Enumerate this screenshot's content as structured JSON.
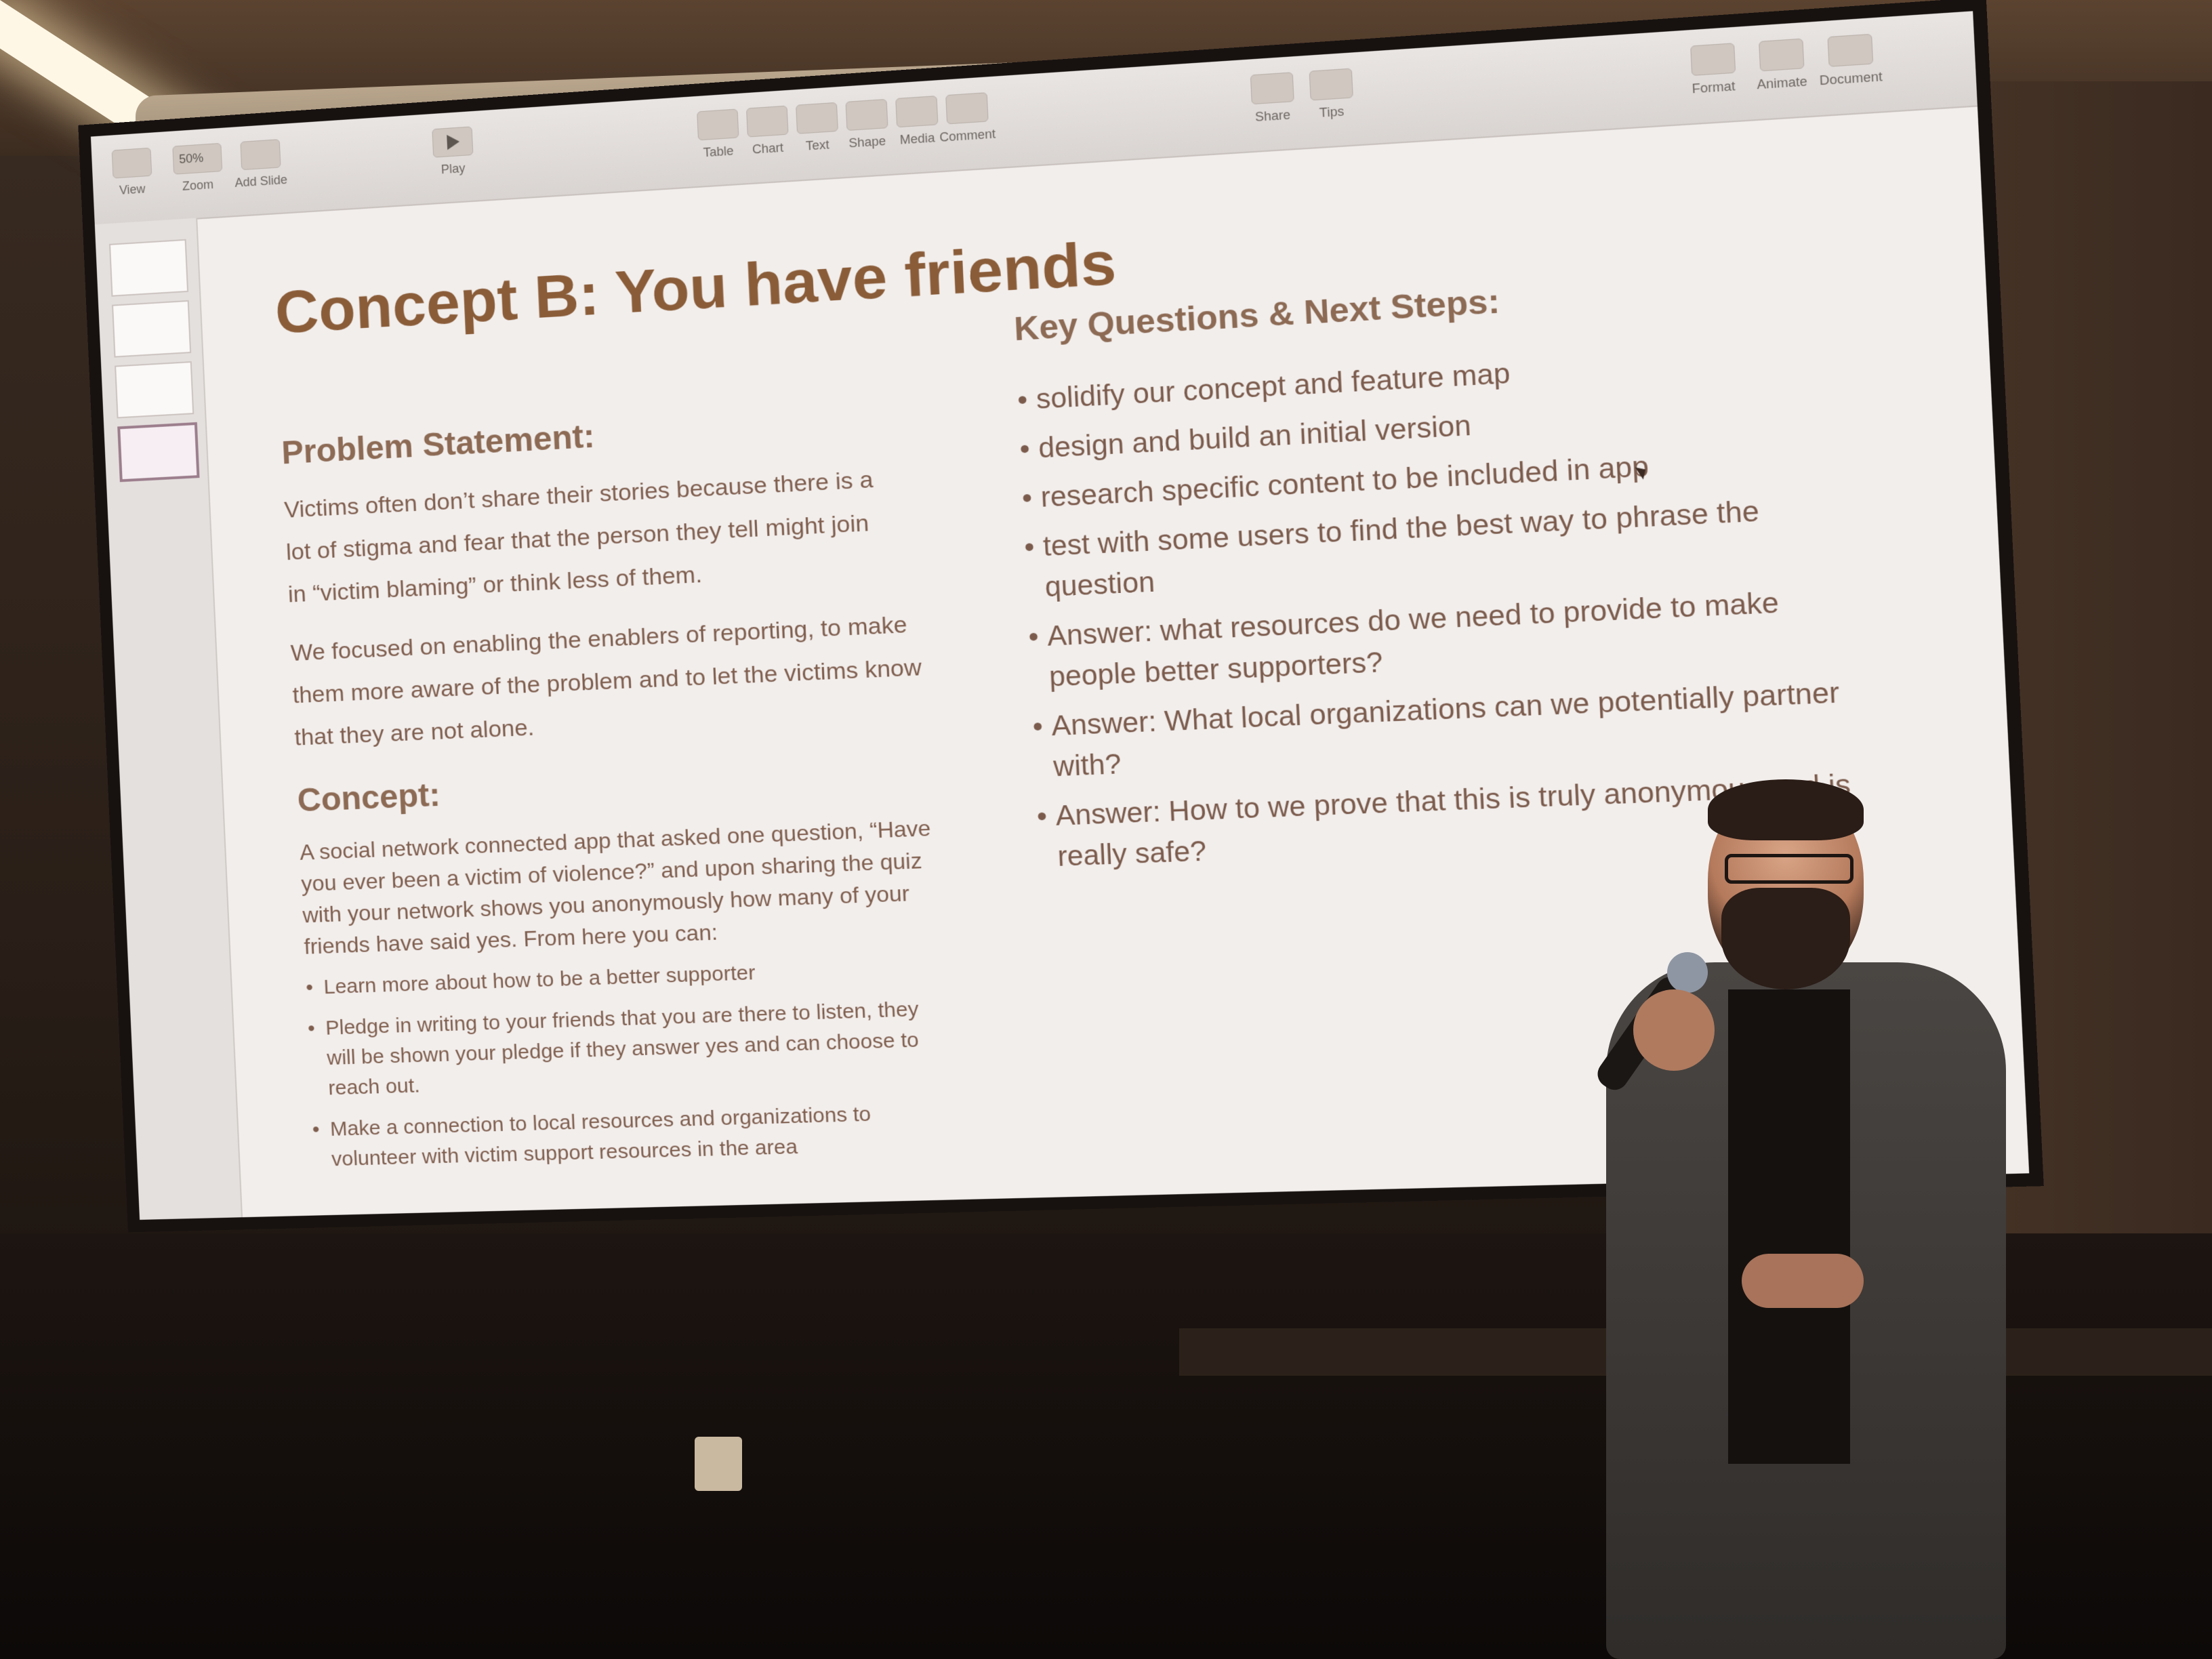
{
  "app": {
    "toolbar": {
      "left": [
        "View",
        "Zoom",
        "Add Slide"
      ],
      "zoom_value": "50%",
      "play": "Play",
      "center": [
        "Table",
        "Chart",
        "Text",
        "Shape",
        "Media",
        "Comment"
      ],
      "right_middle": [
        "Share",
        "Tips"
      ],
      "right": [
        "Format",
        "Animate",
        "Document"
      ]
    }
  },
  "slide": {
    "title": "Concept B: You have friends",
    "problem": {
      "heading": "Problem Statement:",
      "paragraph1": "Victims often don’t share their stories because there is a lot of stigma and fear that the person they tell might join in “victim blaming” or think less of them.",
      "paragraph2": "We focused on enabling the enablers of reporting, to make them more aware of the problem and to let the victims know that they are not alone."
    },
    "concept": {
      "heading": "Concept:",
      "paragraph": "A social network connected app that asked one question, “Have you ever been a victim of violence?” and upon sharing the quiz with your network shows you anonymously how many of your friends have said yes. From here you can:",
      "bullets": [
        "Learn more about how to be a better supporter",
        "Pledge in writing to your friends that you are there to listen, they will be shown your pledge if they answer yes and can choose to reach out.",
        "Make a connection to local resources and organizations to volunteer with victim support resources in the area"
      ]
    },
    "next_steps": {
      "heading": "Key Questions & Next Steps:",
      "bullets": [
        "solidify our concept and feature map",
        "design and build an initial version",
        "research specific content to be included in app",
        "test with some users to find the best way to phrase the question",
        "Answer: what resources do we need to provide to make people better supporters?",
        "Answer: What local organizations can we potentially partner with?",
        "Answer: How to we prove that this is truly anonymous and is really safe?"
      ]
    }
  },
  "colors": {
    "title": "#8a5c38",
    "heading": "#8c6a54",
    "body_text": "#7f5e4e",
    "slide_background": "#f2eeec"
  }
}
